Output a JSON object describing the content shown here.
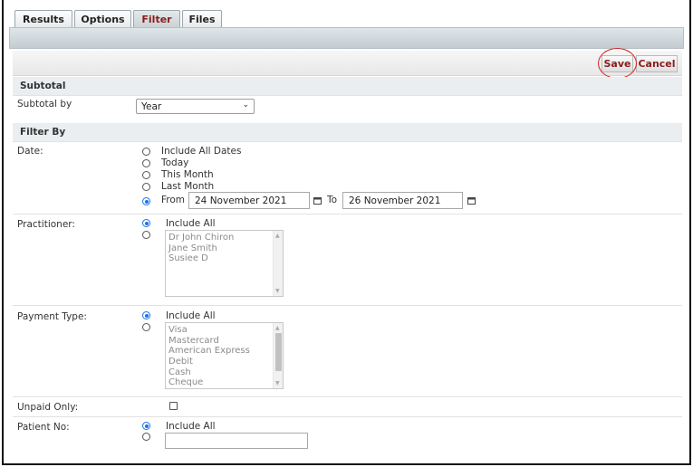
{
  "tabs": [
    {
      "label": "Results",
      "active": false
    },
    {
      "label": "Options",
      "active": false
    },
    {
      "label": "Filter",
      "active": true
    },
    {
      "label": "Files",
      "active": false
    }
  ],
  "toolbar": {
    "save_label": "Save",
    "cancel_label": "Cancel"
  },
  "subtotal": {
    "heading": "Subtotal",
    "label": "Subtotal by",
    "selected": "Year"
  },
  "filter": {
    "heading": "Filter By",
    "date": {
      "label": "Date:",
      "options": [
        "Include All Dates",
        "Today",
        "This Month",
        "Last Month",
        "From"
      ],
      "selected_index": 4,
      "from_value": "24 November 2021",
      "to_label": "To",
      "to_value": "26 November 2021"
    },
    "practitioner": {
      "label": "Practitioner:",
      "include_all": "Include All",
      "items": [
        "Dr John Chiron",
        "Jane Smith",
        "Susiee D"
      ]
    },
    "payment_type": {
      "label": "Payment Type:",
      "include_all": "Include All",
      "items": [
        "Visa",
        "Mastercard",
        "American Express",
        "Debit",
        "Cash",
        "Cheque"
      ]
    },
    "unpaid_only": {
      "label": "Unpaid Only:",
      "checked": false
    },
    "patient_no": {
      "label": "Patient No:",
      "include_all": "Include All",
      "value": ""
    }
  },
  "colors": {
    "accent": "#8a1c1c",
    "radio_selected": "#1a73e8",
    "highlight_ring": "#d32222"
  }
}
